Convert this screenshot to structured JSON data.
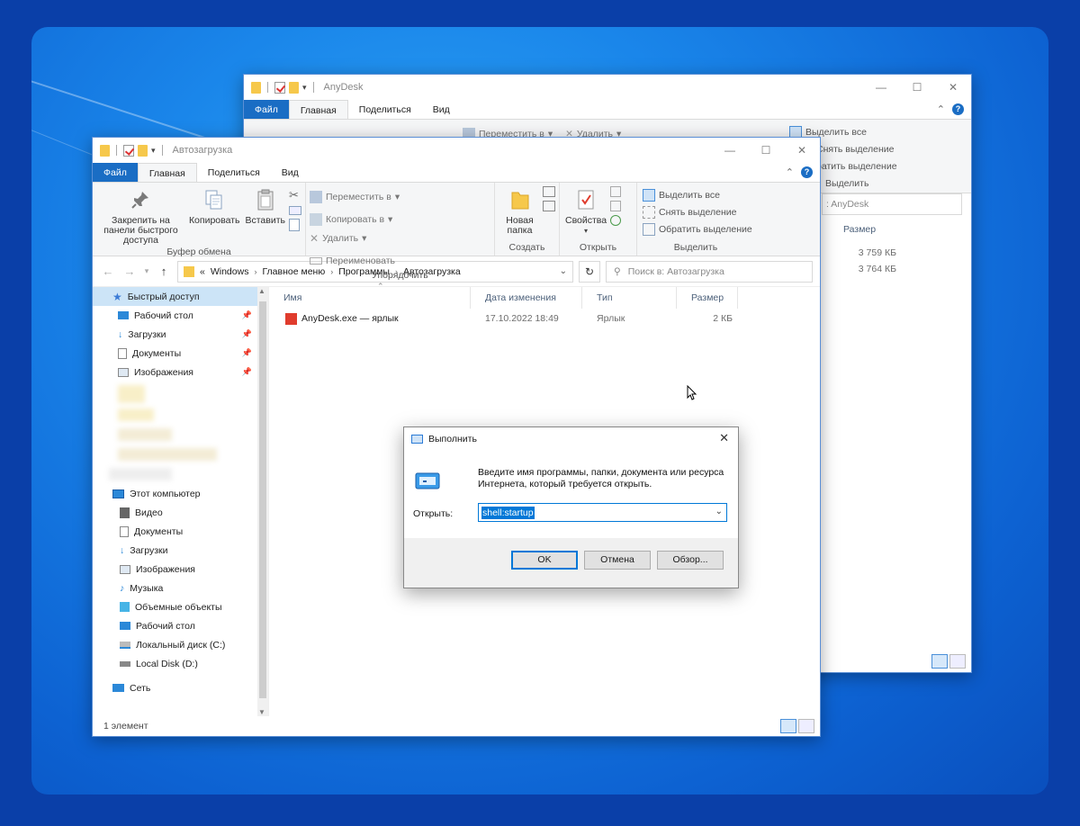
{
  "back_window": {
    "title": "AnyDesk",
    "tabs": [
      "Файл",
      "Главная",
      "Поделиться",
      "Вид"
    ],
    "ribbon_partial": {
      "move_to": "Переместить в",
      "delete": "Удалить",
      "select_all": "Выделить все",
      "deselect": "Снять выделение",
      "invert": "ратить выделение",
      "group": "Выделить"
    },
    "search_partial": ": AnyDesk",
    "size_header": "Размер",
    "sizes": [
      "3 759 КБ",
      "3 764 КБ"
    ]
  },
  "front_window": {
    "title": "Автозагрузка",
    "tabs": [
      "Файл",
      "Главная",
      "Поделиться",
      "Вид"
    ],
    "ribbon": {
      "pin_label": "Закрепить на панели быстрого доступа",
      "copy_label": "Копировать",
      "paste_label": "Вставить",
      "clipboard_group": "Буфер обмена",
      "move_to": "Переместить в",
      "copy_to": "Копировать в",
      "delete": "Удалить",
      "rename": "Переименовать",
      "organize_group": "Упорядочить",
      "new_folder": "Новая папка",
      "create_group": "Создать",
      "properties": "Свойства",
      "open_group": "Открыть",
      "select_all": "Выделить все",
      "deselect": "Снять выделение",
      "invert": "Обратить выделение",
      "select_group": "Выделить"
    },
    "address": {
      "prefix": "«",
      "crumbs": [
        "Windows",
        "Главное меню",
        "Программы",
        "Автозагрузка"
      ]
    },
    "search_placeholder": "Поиск в: Автозагрузка",
    "nav": {
      "quick_access": "Быстрый доступ",
      "quick_items": [
        "Рабочий стол",
        "Загрузки",
        "Документы",
        "Изображения"
      ],
      "this_pc": "Этот компьютер",
      "pc_items": [
        "Видео",
        "Документы",
        "Загрузки",
        "Изображения",
        "Музыка",
        "Объемные объекты",
        "Рабочий стол",
        "Локальный диск (C:)",
        "Local Disk (D:)"
      ],
      "network": "Сеть"
    },
    "columns": [
      "Имя",
      "Дата изменения",
      "Тип",
      "Размер"
    ],
    "files": [
      {
        "name": "AnyDesk.exe — ярлык",
        "date": "17.10.2022 18:49",
        "type": "Ярлык",
        "size": "2 КБ"
      }
    ],
    "status": "1 элемент"
  },
  "run_dialog": {
    "title": "Выполнить",
    "description": "Введите имя программы, папки, документа или ресурса Интернета, который требуется открыть.",
    "open_label": "Открыть:",
    "value": "shell:startup",
    "ok": "OK",
    "cancel": "Отмена",
    "browse": "Обзор..."
  },
  "colors": {
    "accent": "#1a6dc4",
    "selection": "#0078d7",
    "desktop": "#1a86ea"
  }
}
